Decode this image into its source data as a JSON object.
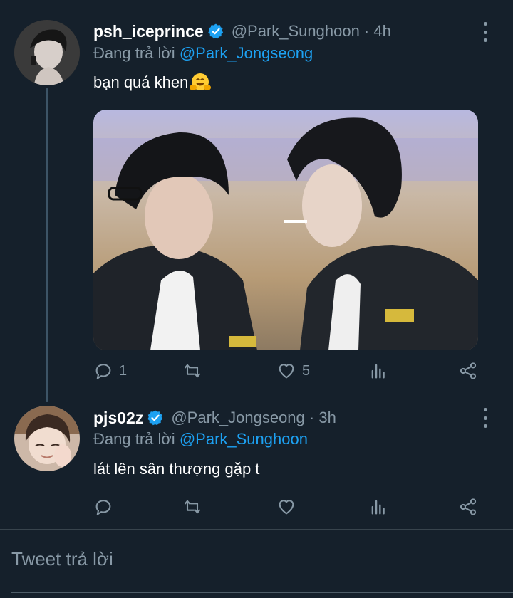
{
  "tweets": [
    {
      "display_name": "psh_iceprince",
      "handle_time": "@Park_Sunghoon · 4h",
      "replying_prefix": "Đang trả lời",
      "replying_mention": "@Park_Jongseong",
      "text": "bạn quá khen",
      "emoji": "hugging-face",
      "has_media": true,
      "replies": "1",
      "likes": "5"
    },
    {
      "display_name": "pjs02z",
      "handle_time": "@Park_Jongseong · 3h",
      "replying_prefix": "Đang trả lời",
      "replying_mention": "@Park_Sunghoon",
      "text": "lát lên sân thượng gặp t",
      "has_media": false
    }
  ],
  "composer": {
    "placeholder": "Tweet trả lời"
  },
  "icons": [
    "verified-badge-icon",
    "more-options-icon",
    "reply-icon",
    "retweet-icon",
    "like-icon",
    "analytics-icon",
    "share-icon"
  ],
  "colors": {
    "background": "#15202b",
    "accent": "#1da1f2",
    "muted": "#8899a6"
  }
}
